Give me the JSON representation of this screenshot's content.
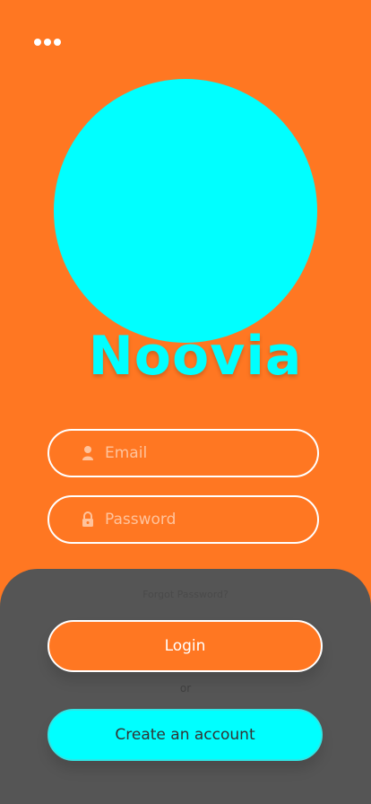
{
  "colors": {
    "background": "#FF7722",
    "accent": "#00FFFF",
    "sheet": "#555555",
    "white": "#FFFFFF"
  },
  "header": {
    "menu_icon": "more-dots-icon"
  },
  "brand": {
    "name": "Noovia"
  },
  "form": {
    "email": {
      "placeholder": "Email",
      "value": "",
      "icon": "user-icon"
    },
    "password": {
      "placeholder": "Password",
      "value": "",
      "icon": "lock-icon"
    },
    "forgot_label": "Forgot Password?"
  },
  "actions": {
    "login_label": "Login",
    "or_label": "or",
    "create_label": "Create an account"
  }
}
